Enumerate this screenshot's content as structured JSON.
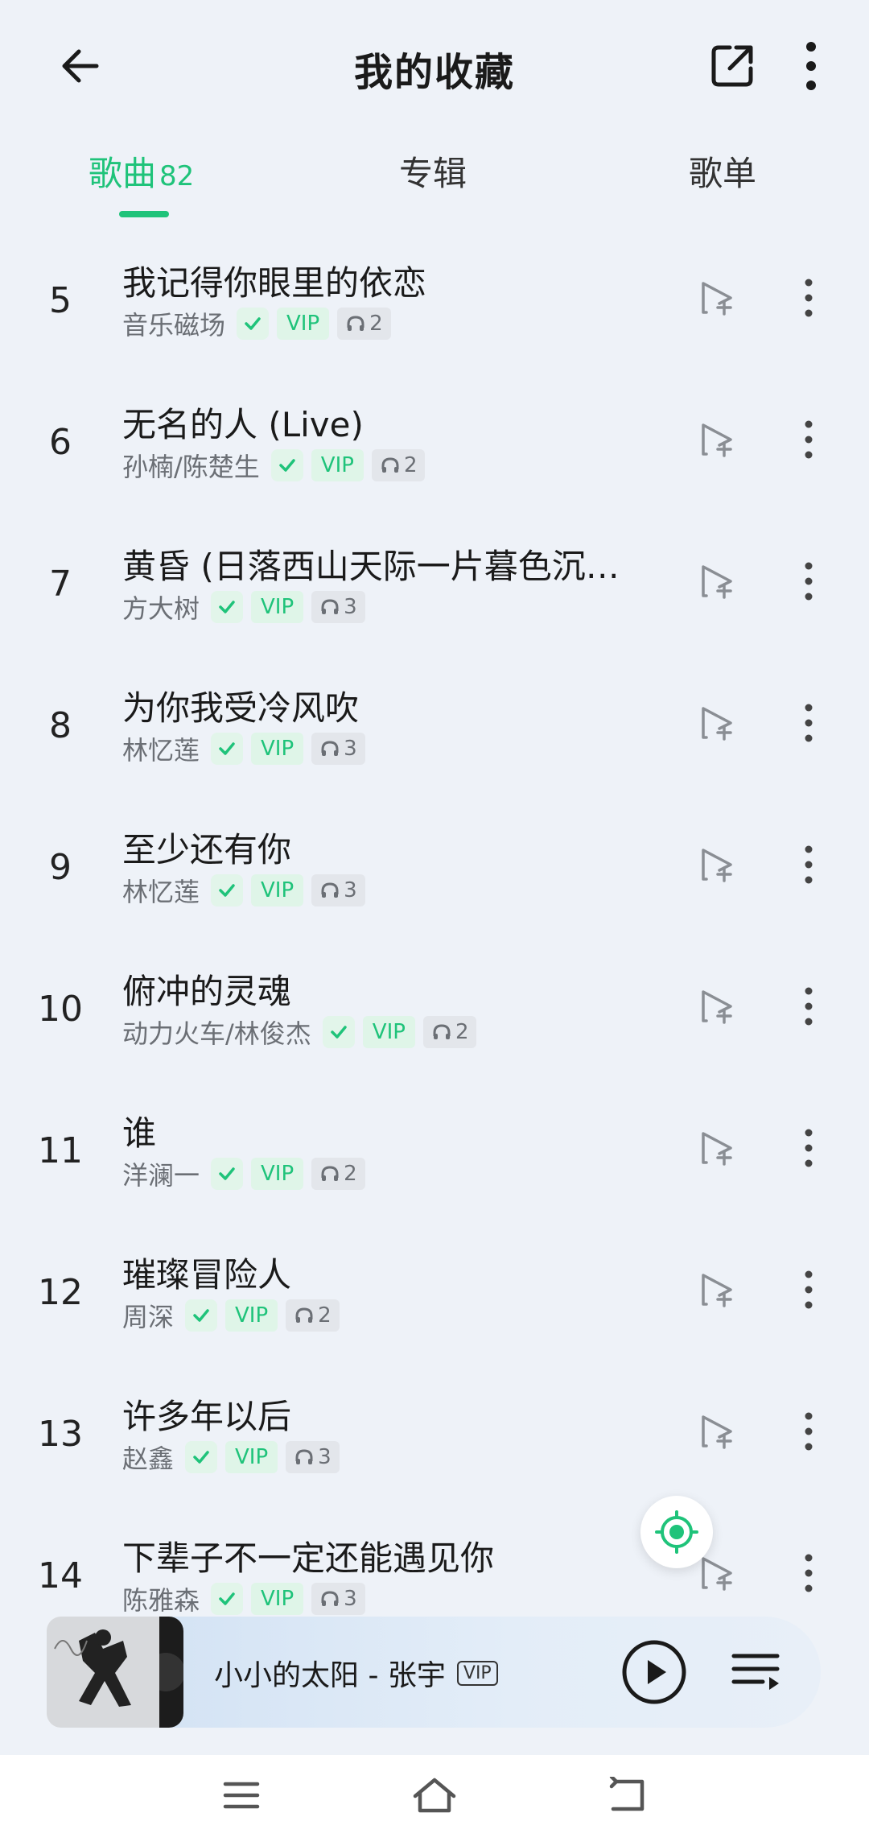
{
  "header": {
    "title": "我的收藏",
    "back_icon": "arrow-left-icon",
    "share_icon": "external-link-icon",
    "more_icon": "vertical-dots-icon"
  },
  "tabs": [
    {
      "label": "歌曲",
      "count": "82",
      "active": true
    },
    {
      "label": "专辑",
      "active": false
    },
    {
      "label": "歌单",
      "active": false
    }
  ],
  "songs": [
    {
      "index": "5",
      "title": "我记得你眼里的依恋",
      "artist": "音乐磁场",
      "vip": "VIP",
      "listens": "2"
    },
    {
      "index": "6",
      "title": "无名的人 (Live)",
      "artist": "孙楠/陈楚生",
      "vip": "VIP",
      "listens": "2"
    },
    {
      "index": "7",
      "title": "黄昏 (日落西山天际一片暮色沉…",
      "artist": "方大树",
      "vip": "VIP",
      "listens": "3"
    },
    {
      "index": "8",
      "title": "为你我受冷风吹",
      "artist": "林忆莲",
      "vip": "VIP",
      "listens": "3"
    },
    {
      "index": "9",
      "title": "至少还有你",
      "artist": "林忆莲",
      "vip": "VIP",
      "listens": "3"
    },
    {
      "index": "10",
      "title": "俯冲的灵魂",
      "artist": "动力火车/林俊杰",
      "vip": "VIP",
      "listens": "2"
    },
    {
      "index": "11",
      "title": "谁",
      "artist": "洋澜一",
      "vip": "VIP",
      "listens": "2"
    },
    {
      "index": "12",
      "title": "璀璨冒险人",
      "artist": "周深",
      "vip": "VIP",
      "listens": "2"
    },
    {
      "index": "13",
      "title": "许多年以后",
      "artist": "赵鑫",
      "vip": "VIP",
      "listens": "3"
    },
    {
      "index": "14",
      "title": "下辈子不一定还能遇见你",
      "artist": "陈雅森",
      "vip": "VIP",
      "listens": "3"
    }
  ],
  "player": {
    "now_playing": "小小的太阳 - 张宇",
    "vip": "VIP"
  },
  "colors": {
    "accent": "#1fc37a",
    "background": "#eef2f8"
  }
}
